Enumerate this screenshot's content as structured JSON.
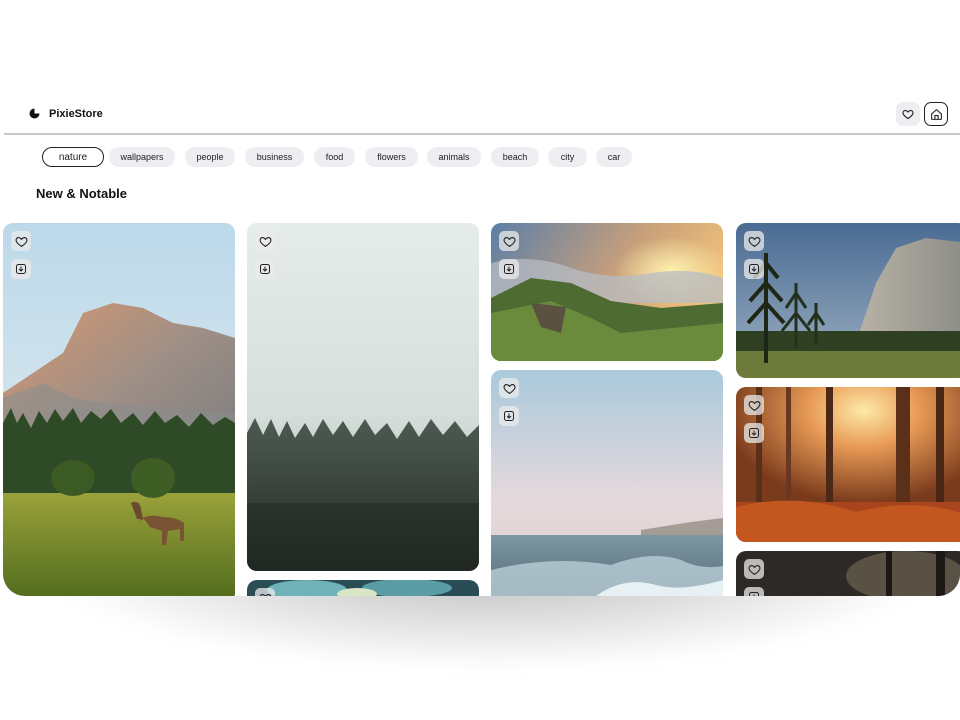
{
  "header": {
    "brand": "PixieStore",
    "icons": {
      "logo": "pixie-logo-icon",
      "favorites": "heart-icon",
      "home": "home-icon"
    }
  },
  "categories": [
    {
      "label": "nature",
      "active": true
    },
    {
      "label": "wallpapers",
      "active": false
    },
    {
      "label": "people",
      "active": false
    },
    {
      "label": "business",
      "active": false
    },
    {
      "label": "food",
      "active": false
    },
    {
      "label": "flowers",
      "active": false
    },
    {
      "label": "animals",
      "active": false
    },
    {
      "label": "beach",
      "active": false
    },
    {
      "label": "city",
      "active": false
    },
    {
      "label": "car",
      "active": false
    }
  ],
  "section": {
    "title": "New & Notable"
  },
  "gallery": {
    "tile_icons": [
      "heart-icon",
      "download-icon"
    ],
    "photos": [
      {
        "subject": "half dome with deer in meadow"
      },
      {
        "subject": "misty pine forest"
      },
      {
        "subject": "forest canopy"
      },
      {
        "subject": "mountain cliffs at sunset"
      },
      {
        "subject": "ocean wave shoreline"
      },
      {
        "subject": "el capitan with pines"
      },
      {
        "subject": "autumn forest with sun rays"
      },
      {
        "subject": "dark forest"
      }
    ]
  }
}
